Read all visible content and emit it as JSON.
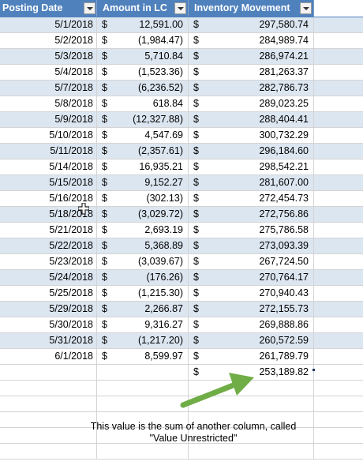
{
  "headers": [
    "Posting Date",
    "Amount in LC",
    "Inventory Movement"
  ],
  "currency_symbol": "$",
  "rows": [
    {
      "date": "5/1/2018",
      "amount": "12,591.00",
      "movement": "297,580.74"
    },
    {
      "date": "5/2/2018",
      "amount": "(1,984.47)",
      "movement": "284,989.74"
    },
    {
      "date": "5/3/2018",
      "amount": "5,710.84",
      "movement": "286,974.21"
    },
    {
      "date": "5/4/2018",
      "amount": "(1,523.36)",
      "movement": "281,263.37"
    },
    {
      "date": "5/7/2018",
      "amount": "(6,236.52)",
      "movement": "282,786.73"
    },
    {
      "date": "5/8/2018",
      "amount": "618.84",
      "movement": "289,023.25"
    },
    {
      "date": "5/9/2018",
      "amount": "(12,327.88)",
      "movement": "288,404.41"
    },
    {
      "date": "5/10/2018",
      "amount": "4,547.69",
      "movement": "300,732.29"
    },
    {
      "date": "5/11/2018",
      "amount": "(2,357.61)",
      "movement": "296,184.60"
    },
    {
      "date": "5/14/2018",
      "amount": "16,935.21",
      "movement": "298,542.21"
    },
    {
      "date": "5/15/2018",
      "amount": "9,152.27",
      "movement": "281,607.00"
    },
    {
      "date": "5/16/2018",
      "amount": "(302.13)",
      "movement": "272,454.73"
    },
    {
      "date": "5/18/2018",
      "amount": "(3,029.72)",
      "movement": "272,756.86"
    },
    {
      "date": "5/21/2018",
      "amount": "2,693.19",
      "movement": "275,786.58"
    },
    {
      "date": "5/22/2018",
      "amount": "5,368.89",
      "movement": "273,093.39"
    },
    {
      "date": "5/23/2018",
      "amount": "(3,039.67)",
      "movement": "267,724.50"
    },
    {
      "date": "5/24/2018",
      "amount": "(176.26)",
      "movement": "270,764.17"
    },
    {
      "date": "5/25/2018",
      "amount": "(1,215.30)",
      "movement": "270,940.43"
    },
    {
      "date": "5/29/2018",
      "amount": "2,266.87",
      "movement": "272,155.73"
    },
    {
      "date": "5/30/2018",
      "amount": "9,316.27",
      "movement": "269,888.86"
    },
    {
      "date": "5/31/2018",
      "amount": "(1,217.20)",
      "movement": "260,572.59"
    },
    {
      "date": "6/1/2018",
      "amount": "8,599.97",
      "movement": "261,789.79"
    }
  ],
  "total": {
    "movement": "253,189.82"
  },
  "note": "This value is the sum of another column, called \"Value Unrestricted\"",
  "colors": {
    "header_bg": "#4f81bd",
    "band": "#dce6f1",
    "arrow": "#70ad47",
    "grid": "#d4d4d4"
  }
}
